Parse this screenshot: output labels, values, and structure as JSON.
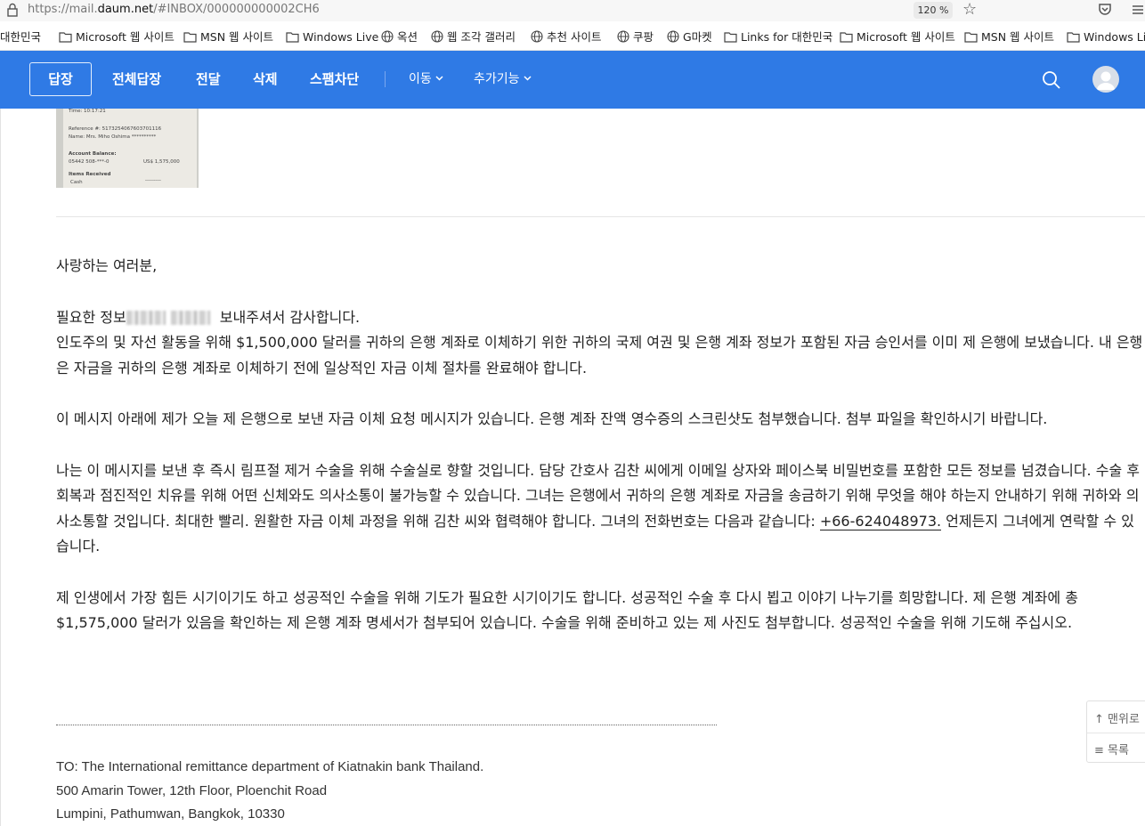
{
  "browser": {
    "url_prefix": "https://mail.",
    "url_domain": "daum.net",
    "url_suffix": "/#INBOX/000000000002CH6",
    "zoom": "120 %"
  },
  "bookmarks": [
    {
      "label": "대한민국",
      "icon": "none"
    },
    {
      "label": "Microsoft 웹 사이트",
      "icon": "folder-icon"
    },
    {
      "label": "MSN 웹 사이트",
      "icon": "folder-icon"
    },
    {
      "label": "Windows Live",
      "icon": "folder-icon"
    },
    {
      "label": "옥션",
      "icon": "globe-icon"
    },
    {
      "label": "웹 조각 갤러리",
      "icon": "globe-icon"
    },
    {
      "label": "추천 사이트",
      "icon": "globe-icon"
    },
    {
      "label": "쿠팡",
      "icon": "globe-icon"
    },
    {
      "label": "G마켓",
      "icon": "globe-icon"
    },
    {
      "label": "Links for 대한민국",
      "icon": "folder-icon"
    },
    {
      "label": "Microsoft 웹 사이트",
      "icon": "folder-icon"
    },
    {
      "label": "MSN 웹 사이트",
      "icon": "folder-icon"
    },
    {
      "label": "Windows Live",
      "icon": "folder-icon"
    }
  ],
  "toolbar": {
    "reply": "답장",
    "reply_all": "전체답장",
    "forward": "전달",
    "delete": "삭제",
    "spam": "스팸차단",
    "move": "이동",
    "more": "추가기능",
    "accent_color": "#2f7ae5"
  },
  "receipt": {
    "time": "Time: 10:17:21",
    "reference": "Reference #:  5173254067603701116",
    "name": "Name:  Mrs. Miho Oshima **********",
    "balance_label": "Account Balance:",
    "account": "05442 508-***-0",
    "amount": "US$ 1,575,000",
    "items_label": "Items Received",
    "cash": "Cash",
    "cash_value": "---------"
  },
  "message": {
    "greeting": "사랑하는 여러분,",
    "p1_a": "필요한 정보",
    "p1_b": " 보내주셔서 감사합니다.",
    "p1_c": "인도주의 및 자선 활동을 위해 $1,500,000 달러를 귀하의 은행 계좌로 이체하기 위한 귀하의 국제 여권 및 은행 계좌 정보가 포함된 자금 승인서를 이미 제 은행에 보냈습니다. 내 은행은 자금을 귀하의 은행 계좌로 이체하기 전에 일상적인 자금 이체 절차를 완료해야 합니다.",
    "p2": "이 메시지 아래에 제가 오늘 제 은행으로 보낸 자금 이체 요청 메시지가 있습니다. 은행 계좌 잔액 영수증의 스크린샷도 첨부했습니다. 첨부 파일을 확인하시기 바랍니다.",
    "p3_a": "나는 이 메시지를 보낸 후 즉시 림프절 제거 수술을 위해 수술실로 향할 것입니다. 담당 간호사 김찬 씨에게 이메일 상자와 페이스북 비밀번호를 포함한 모든 정보를 넘겼습니다. 수술 후 회복과 점진적인 치유를 위해 어떤 신체와도 의사소통이 불가능할 수 있습니다. 그녀는 은행에서 귀하의 은행 계좌로 자금을 송금하기 위해 무엇을 해야 하는지 안내하기 위해 귀하와 의사소통할 것입니다. 최대한 빨리. 원활한 자금 이체 과정을 위해 김찬 씨와 협력해야 합니다. 그녀의 전화번호는 다음과 같습니다: ",
    "phone": "+66-624048973.",
    "p3_b": " 언제든지 그녀에게 연락할 수 있습니다.",
    "p4": "제 인생에서 가장 힘든 시기이기도 하고 성공적인 수술을 위해 기도가 필요한 시기이기도 합니다. 성공적인 수술 후 다시 뵙고 이야기 나누기를 희망합니다. 제 은행 계좌에 총 $1,575,000 달러가 있음을 확인하는 제 은행 계좌 명세서가 첨부되어 있습니다. 수술을 위해 준비하고 있는 제 사진도 첨부합니다. 성공적인 수술을 위해 기도해 주십시오."
  },
  "address": {
    "line1": "TO: The International remittance department of Kiatnakin bank Thailand.",
    "line2": "500 Amarin Tower, 12th Floor, Ploenchit Road",
    "line3": "Lumpini, Pathumwan, Bangkok, 10330"
  },
  "float_nav": {
    "top": "맨위로",
    "list": "목록"
  }
}
